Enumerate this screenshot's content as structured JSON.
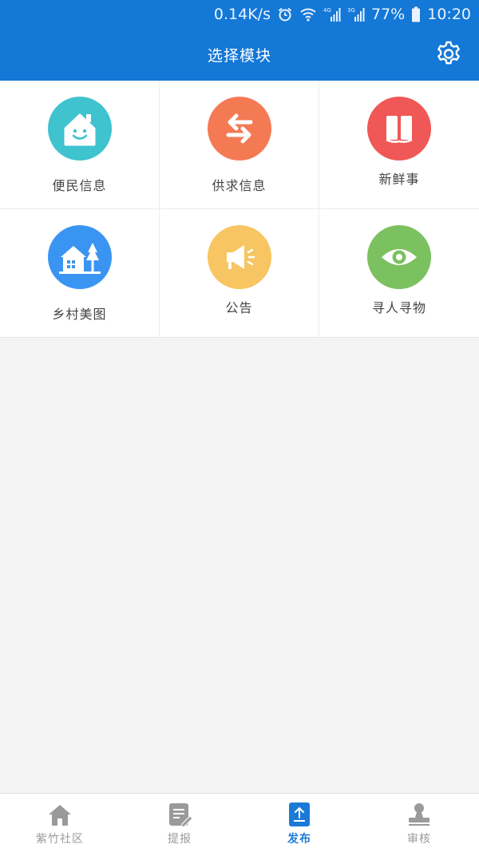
{
  "status_bar": {
    "speed": "0.14K/s",
    "network_4g": "4G",
    "network_3g": "3G",
    "battery": "77%",
    "time": "10:20"
  },
  "header": {
    "title": "选择模块",
    "settings_icon": "gear-icon"
  },
  "modules": [
    {
      "label": "便民信息",
      "icon": "smiling-house-icon",
      "color": "#3ec3cf"
    },
    {
      "label": "供求信息",
      "icon": "swap-arrows-icon",
      "color": "#f47a54"
    },
    {
      "label": "新鲜事",
      "icon": "open-book-icon",
      "color": "#ef5856"
    },
    {
      "label": "乡村美图",
      "icon": "village-house-icon",
      "color": "#3a95f2"
    },
    {
      "label": "公告",
      "icon": "megaphone-icon",
      "color": "#f7c562"
    },
    {
      "label": "寻人寻物",
      "icon": "eye-icon",
      "color": "#7cc160"
    }
  ],
  "bottom_nav": [
    {
      "label": "紫竹社区",
      "icon": "home-icon",
      "active": false
    },
    {
      "label": "提报",
      "icon": "report-edit-icon",
      "active": false
    },
    {
      "label": "发布",
      "icon": "upload-icon",
      "active": true
    },
    {
      "label": "审核",
      "icon": "stamp-icon",
      "active": false
    }
  ],
  "colors": {
    "header_bg": "#1478d7",
    "active_tab": "#1b7ad8",
    "inactive_tab": "#9a9a9a"
  }
}
